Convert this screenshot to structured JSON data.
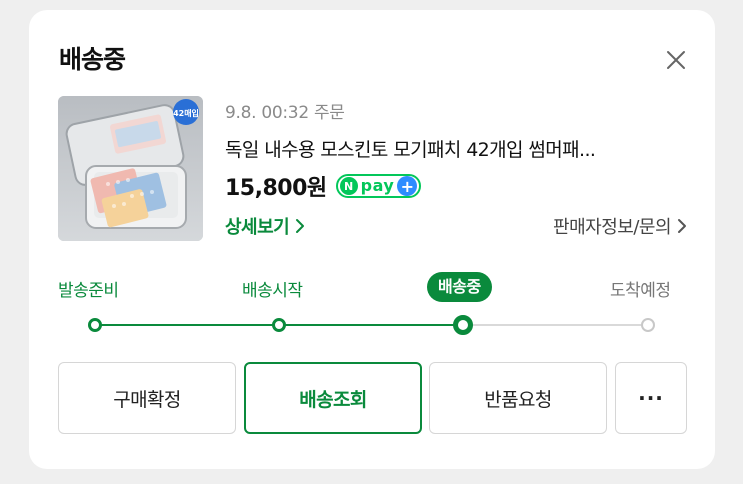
{
  "header": {
    "title": "배송중",
    "close_icon": "close-icon"
  },
  "order": {
    "date": "9.8. 00:32 주문",
    "product_name": "독일 내수용 모스킨토 모기패치 42개입 썸머패...",
    "thumbnail_badge": "42매입",
    "price": "15,800원",
    "npay": {
      "n": "N",
      "pay": "pay",
      "plus": "+"
    },
    "detail_link": "상세보기",
    "seller_link": "판매자정보/문의"
  },
  "progress": {
    "steps": [
      {
        "label": "발송준비",
        "state": "done"
      },
      {
        "label": "배송시작",
        "state": "done"
      },
      {
        "label": "배송중",
        "state": "current"
      },
      {
        "label": "도착예정",
        "state": "todo"
      }
    ],
    "current_index": 2
  },
  "actions": {
    "confirm": "구매확정",
    "track": "배송조회",
    "return": "반품요청",
    "more": "···"
  },
  "colors": {
    "accent": "#0a8a3c",
    "npay_green": "#03c75a",
    "npay_blue": "#2d8cff",
    "inactive": "#d9d9d9"
  }
}
